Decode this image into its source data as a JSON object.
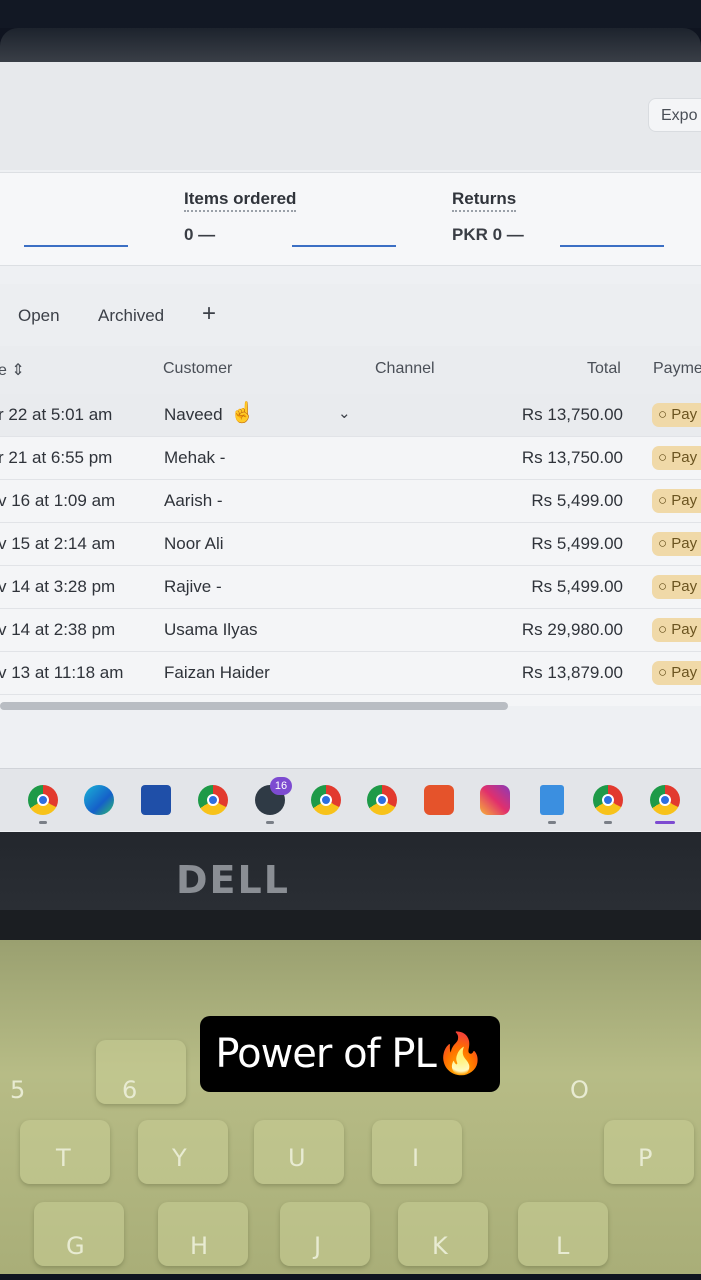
{
  "header": {
    "export_label": "Expo"
  },
  "metrics": [
    {
      "title": "Items ordered",
      "value": "0 —"
    },
    {
      "title": "Returns",
      "value": "PKR 0 —"
    }
  ],
  "tabs": {
    "open": "Open",
    "archived": "Archived",
    "add": "+"
  },
  "table": {
    "columns": {
      "date": "e ⇕",
      "customer": "Customer",
      "channel": "Channel",
      "total": "Total",
      "payment": "Payme"
    },
    "rows": [
      {
        "date": "r 22 at 5:01 am",
        "customer": "Naveed",
        "total": "Rs 13,750.00",
        "payment": "○ Pay"
      },
      {
        "date": "r 21 at 6:55 pm",
        "customer": "Mehak -",
        "total": "Rs 13,750.00",
        "payment": "○ Pay"
      },
      {
        "date": "v 16 at 1:09 am",
        "customer": "Aarish -",
        "total": "Rs 5,499.00",
        "payment": "○ Pay"
      },
      {
        "date": "v 15 at 2:14 am",
        "customer": "Noor Ali",
        "total": "Rs 5,499.00",
        "payment": "○ Pay"
      },
      {
        "date": "v 14 at 3:28 pm",
        "customer": "Rajive -",
        "total": "Rs 5,499.00",
        "payment": "○ Pay"
      },
      {
        "date": "v 14 at 2:38 pm",
        "customer": "Usama Ilyas",
        "total": "Rs 29,980.00",
        "payment": "○ Pay"
      },
      {
        "date": "v 13 at 11:18 am",
        "customer": "Faizan Haider",
        "total": "Rs 13,879.00",
        "payment": "○ Pay"
      }
    ]
  },
  "taskbar": {
    "whatsapp_badge": "16"
  },
  "laptop": {
    "brand": "DELL"
  },
  "keyboard": {
    "keys": [
      "6",
      "T",
      "Y",
      "U",
      "I",
      "O",
      "P",
      "G",
      "H",
      "J",
      "K",
      "L",
      "5"
    ]
  },
  "caption": "Power of PL🔥",
  "colors": {
    "accent": "#3b6fc4",
    "badge_bg": "#f0d9a8",
    "caption_bg": "#000000"
  }
}
